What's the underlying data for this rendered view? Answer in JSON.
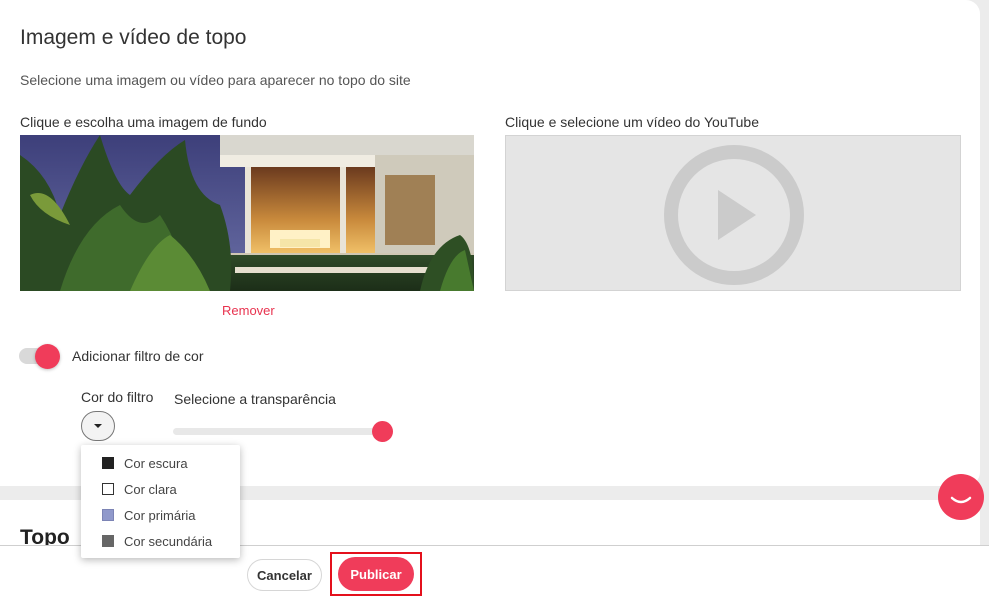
{
  "section": {
    "title": "Imagem e vídeo de topo",
    "subtitle": "Selecione uma imagem ou vídeo para aparecer no topo do site"
  },
  "image_picker": {
    "label": "Clique e escolha uma imagem de fundo",
    "remove_label": "Remover"
  },
  "video_picker": {
    "label": "Clique e selecione um vídeo do YouTube",
    "icon": "play-icon"
  },
  "filter": {
    "toggle_label": "Adicionar filtro de cor",
    "toggle_on": true,
    "color_label": "Cor do filtro",
    "transparency_label": "Selecione a transparência",
    "transparency_value": 1.0,
    "options": [
      {
        "label": "Cor escura",
        "color": "#222222"
      },
      {
        "label": "Cor clara",
        "color": "#ffffff"
      },
      {
        "label": "Cor primária",
        "color": "#9099cb"
      },
      {
        "label": "Cor secundária",
        "color": "#666666"
      }
    ]
  },
  "next_section": {
    "title": "Topo"
  },
  "footer": {
    "cancel_label": "Cancelar",
    "publish_label": "Publicar"
  },
  "colors": {
    "accent": "#f03c5a",
    "highlight_border": "#e4101c"
  }
}
